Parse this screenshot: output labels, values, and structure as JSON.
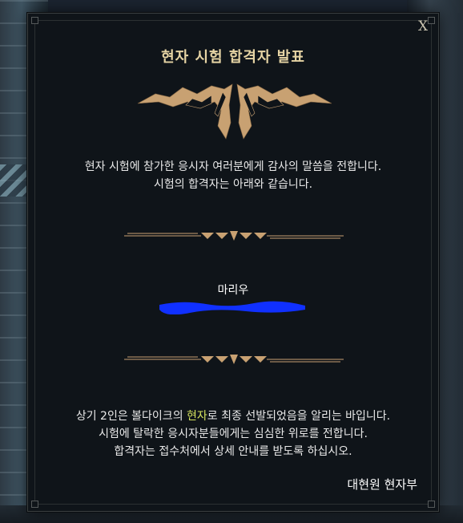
{
  "dialog": {
    "close_label": "X",
    "title": "현자 시험 합격자 발표",
    "intro_line1": "현자 시험에 참가한 응시자 여러분에게 감사의 말씀을 전합니다.",
    "intro_line2": "시험의 합격자는 아래와 같습니다.",
    "winner_name": "마리우",
    "redacted_color": "#1030ff",
    "result_line1_before": "상기 2인은 볼다이크의 ",
    "result_line1_highlight": "현자",
    "result_line1_after": "로 최종 선발되었음을 알리는 바입니다.",
    "result_line2": "시험에 탈락한 응시자분들에게는 심심한 위로를 전합니다.",
    "result_line3": "합격자는 접수처에서 상세 안내를 받도록 하십시오.",
    "signature": "대현원 현자부",
    "highlight_color": "#d4e25e",
    "title_color": "#e6d4a4",
    "ornament_color": "#c8a172"
  }
}
